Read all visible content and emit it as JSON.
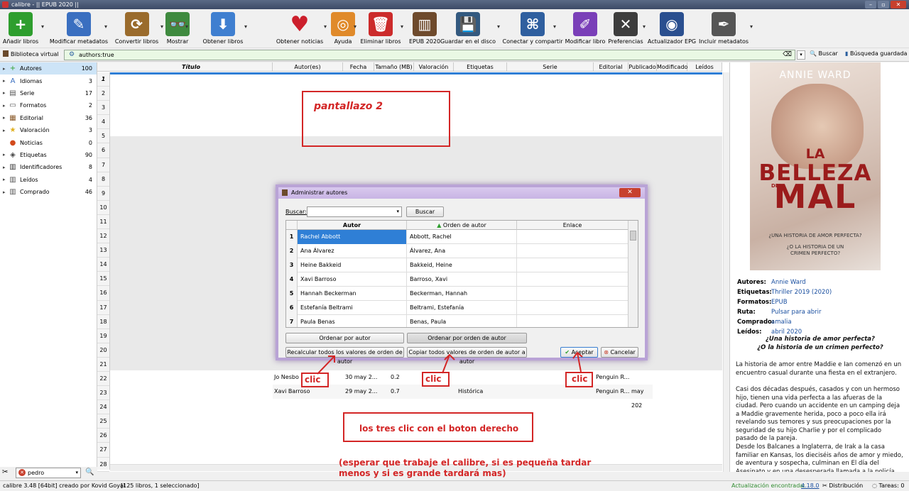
{
  "window": {
    "title": "calibre - || EPUB 2020 ||"
  },
  "toolbar": {
    "buttons": [
      {
        "label": "Añadir libros",
        "color": "#2e9e2e",
        "glyph": "+"
      },
      {
        "label": "Modificar metadatos",
        "color": "#3a6fc0",
        "glyph": "✎"
      },
      {
        "label": "Convertir libros",
        "color": "#9a6b2c",
        "glyph": "⟳"
      },
      {
        "label": "Mostrar",
        "color": "#3f8a3f",
        "glyph": "👓"
      },
      {
        "label": "Obtener libros",
        "color": "#3f7fd0",
        "glyph": "⬇"
      },
      {
        "label": "Obtener noticias",
        "color": "#d24a1c",
        "glyph": "N"
      },
      {
        "label": "Ayuda",
        "color": "#e08a2a",
        "glyph": "◎"
      },
      {
        "label": "Eliminar libros",
        "color": "#cc2b2b",
        "glyph": "🗑"
      },
      {
        "label": "EPUB 2020",
        "color": "#6e4a2c",
        "glyph": "▥"
      },
      {
        "label": "Guardar en el disco",
        "color": "#33597f",
        "glyph": "💾"
      },
      {
        "label": "Conectar y compartir",
        "color": "#2f5f9f",
        "glyph": "⌘"
      },
      {
        "label": "Modificar libro",
        "color": "#7a3fb8",
        "glyph": "✐"
      },
      {
        "label": "Preferencias",
        "color": "#3d3d3d",
        "glyph": "✕"
      },
      {
        "label": "Actualizador EPG",
        "color": "#2a4f8f",
        "glyph": "◉"
      },
      {
        "label": "Incluir metadatos",
        "color": "#555555",
        "glyph": "✒"
      }
    ]
  },
  "vlib": {
    "label": "Biblioteca virtual",
    "search_value": "authors:true",
    "search_button": "Buscar",
    "saved_search": "Búsqueda guardada"
  },
  "tag_browser": [
    {
      "label": "Autores",
      "count": "100",
      "icon": "+",
      "color": "#2e9e2e"
    },
    {
      "label": "Idiomas",
      "count": "3",
      "icon": "A",
      "color": "#3a6fc0"
    },
    {
      "label": "Serie",
      "count": "17",
      "icon": "▤",
      "color": "#555"
    },
    {
      "label": "Formatos",
      "count": "2",
      "icon": "▭",
      "color": "#555"
    },
    {
      "label": "Editorial",
      "count": "36",
      "icon": "▦",
      "color": "#8a5a2a"
    },
    {
      "label": "Valoración",
      "count": "3",
      "icon": "★",
      "color": "#e0b020"
    },
    {
      "label": "Noticias",
      "count": "0",
      "icon": "●",
      "color": "#d24a1c"
    },
    {
      "label": "Etiquetas",
      "count": "90",
      "icon": "◈",
      "color": "#444"
    },
    {
      "label": "Identificadores",
      "count": "8",
      "icon": "▥",
      "color": "#333"
    },
    {
      "label": "Leídos",
      "count": "4",
      "icon": "▥",
      "color": "#555"
    },
    {
      "label": "Comprado",
      "count": "46",
      "icon": "▥",
      "color": "#555"
    }
  ],
  "left_search": {
    "value": "pedro"
  },
  "columns": [
    "Título",
    "Autor(es)",
    "Fecha",
    "Tamaño (MB)",
    "Valoración",
    "Etiquetas",
    "Serie",
    "Editorial",
    "Publicado",
    "Modificado",
    "Leídos"
  ],
  "row_numbers": [
    "1",
    "2",
    "3",
    "4",
    "5",
    "6",
    "7",
    "8",
    "9",
    "10",
    "11",
    "12",
    "13",
    "14",
    "15",
    "16",
    "17",
    "18",
    "19",
    "20",
    "21",
    "22",
    "23",
    "24",
    "25",
    "26",
    "27",
    "28"
  ],
  "visible_rows": [
    {
      "author": "Jo Nesbo",
      "date": "30 may 2...",
      "size": "0.2",
      "tags": "",
      "publisher": "Penguin R...",
      "published": ""
    },
    {
      "author": "Xavi Barroso",
      "date": "29 may 2...",
      "size": "0.7",
      "tags": "Histórica",
      "publisher": "Penguin R...",
      "published": "may 202"
    }
  ],
  "cover": {
    "author": "ANNIE WARD",
    "title_la": "LA",
    "title_belleza": "BELLEZA",
    "title_del": "DEL",
    "title_mal": "MAL",
    "tagline1": "¿UNA HISTORIA DE AMOR PERFECTA?",
    "tagline2": "¿O LA HISTORIA DE UN CRIMEN PERFECTO?"
  },
  "book_details": [
    {
      "key": "Autores:",
      "value": "Annie Ward"
    },
    {
      "key": "Etiquetas:",
      "value": "Thriller 2019 (2020)"
    },
    {
      "key": "Formatos:",
      "value": "EPUB"
    },
    {
      "key": "Ruta:",
      "value": "Pulsar para abrir"
    },
    {
      "key": "Comprado:",
      "value": "amalia"
    },
    {
      "key": "Leídos:",
      "value": "abril 2020"
    }
  ],
  "description": {
    "headline1": "¿Una historia de amor perfecta?",
    "headline2": "¿O la historia de un crimen perfecto?",
    "p1": "La historia de amor entre Maddie e Ian comenzó en un encuentro casual durante una fiesta en el extranjero.",
    "p2": "Casi dos décadas después, casados y con un hermoso hijo, tienen una vida perfecta a las afueras de la ciudad. Pero cuando un accidente en un camping deja a Maddie gravemente herida, poco a poco ella irá revelando sus temores y sus preocupaciones por la seguridad de su hijo Charlie y por el complicado pasado de la pareja.",
    "p3": "Desde los Balcanes a Inglaterra, de Irak a la casa familiar en Kansas, los dieciséis años de amor y miedo, de aventura y sospecha, culminan en El día del Asesinato y en una desesperada llamada a la policía ante la escena de un crimen impactante."
  },
  "statusbar": {
    "left": "calibre 3.48 [64bit] creado por Kovid Goyal",
    "count": "[125 libros, 1 seleccionado]",
    "update_label": "Actualización encontrada:",
    "update_version": "4.18.0",
    "distribution": "Distribución",
    "tasks": "Tareas: 0"
  },
  "dialog": {
    "title": "Administrar autores",
    "search_label": "Buscar:",
    "search_value": "",
    "search_button": "Buscar",
    "headers": [
      "Autor",
      "Orden de autor",
      "Enlace"
    ],
    "rows": [
      {
        "n": "1",
        "author": "Rachel Abbott",
        "sort": "Abbott, Rachel",
        "link": ""
      },
      {
        "n": "2",
        "author": "Ana Álvarez",
        "sort": "Álvarez, Ana",
        "link": ""
      },
      {
        "n": "3",
        "author": "Heine Bakkeid",
        "sort": "Bakkeid, Heine",
        "link": ""
      },
      {
        "n": "4",
        "author": "Xavi Barroso",
        "sort": "Barroso, Xavi",
        "link": ""
      },
      {
        "n": "5",
        "author": "Hannah Beckerman",
        "sort": "Beckerman, Hannah",
        "link": ""
      },
      {
        "n": "6",
        "author": "Estefanía Beltrami",
        "sort": "Beltrami, Estefanía",
        "link": ""
      },
      {
        "n": "7",
        "author": "Paula Benas",
        "sort": "Benas, Paula",
        "link": ""
      }
    ],
    "sort_by_author": "Ordenar por autor",
    "sort_by_author_sort": "Ordenar por orden de autor",
    "recalc": "Recalcular todos los valores de orden de autor",
    "copy": "Copiar todos valores de orden de autor a autor",
    "ok": "Aceptar",
    "cancel": "Cancelar"
  },
  "annotations": {
    "title": "pantallazo 2",
    "clic": "clic",
    "instruction": "los tres clic con el boton derecho",
    "note1": "(esperar que trabaje el calibre, si es pequeña tardar",
    "note2": "menos y si es grande tardará mas)"
  },
  "colors": {
    "accent": "#2f7fd6",
    "annotation_red": "#d32626",
    "link_blue": "#1a4fa0",
    "dialog_border": "#b9a3d6"
  }
}
